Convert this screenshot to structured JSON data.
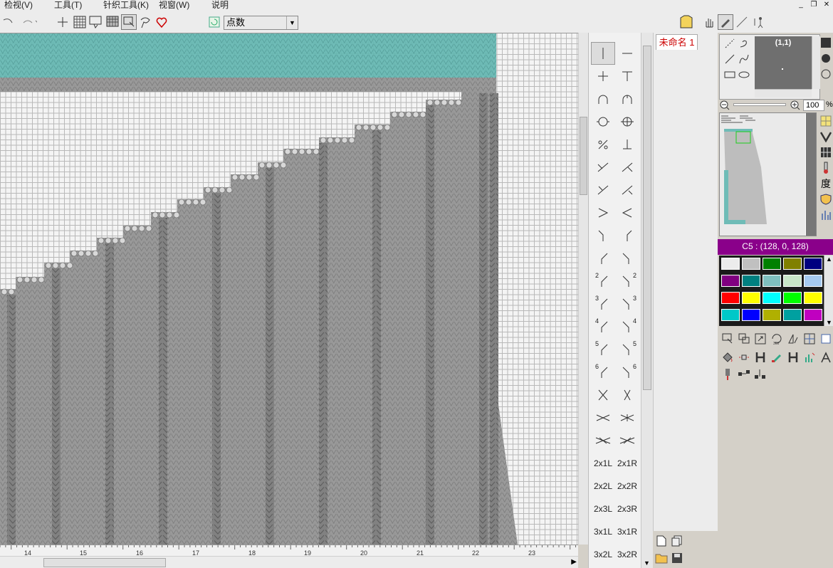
{
  "menu": {
    "view": "检视(V)",
    "tools": "工具(T)",
    "knit_tools": "针织工具(K)",
    "window": "视窗(W)",
    "help": "说明"
  },
  "window_controls": {
    "minimize": "_",
    "restore": "❐",
    "close": "✕"
  },
  "toolbar": {
    "mode_select_value": "点数",
    "icons": [
      "undo-icon",
      "redo-icon",
      "crosshair-icon",
      "grid-icon",
      "select-area-icon",
      "pattern-grid-icon",
      "select-drag-icon",
      "lasso-icon",
      "heart-icon",
      "refresh-icon"
    ]
  },
  "ruler": {
    "ticks": [
      "14",
      "15",
      "16",
      "17",
      "18",
      "19",
      "20",
      "21",
      "22",
      "23"
    ]
  },
  "symbols": {
    "labels": [
      {
        "left": "2x1L",
        "right": "2x1R"
      },
      {
        "left": "2x2L",
        "right": "2x2R"
      },
      {
        "left": "2x3L",
        "right": "2x3R"
      },
      {
        "left": "3x1L",
        "right": "3x1R"
      },
      {
        "left": "3x2L",
        "right": "3x2R"
      }
    ],
    "numbers": [
      "2",
      "2",
      "3",
      "3",
      "4",
      "4",
      "5",
      "5",
      "6",
      "6"
    ]
  },
  "document": {
    "tab_label": "未命名 1"
  },
  "right_panel": {
    "preview_coords": "(1,1)",
    "zoom_value": "100",
    "zoom_unit": "%",
    "color_label": "C5 : (128, 0, 128)",
    "side_text": "度",
    "palette": [
      [
        "#ececec",
        "#c0c0c0",
        "#008000",
        "#808000",
        "#000080"
      ],
      [
        "#800080",
        "#008080",
        "#7fbfbf",
        "#c8e6c8",
        "#a6caf0"
      ],
      [
        "#ff0000",
        "#ffff00",
        "#00ffff",
        "#00ff00",
        "#ffff00"
      ],
      [
        "#00c8c8",
        "#0000ff",
        "#b0b000",
        "#00a0a0",
        "#c000c0"
      ]
    ]
  },
  "colors": {
    "knit_gray": "#9a9a9a",
    "knit_teal": "#6fbcb7",
    "grid_bg": "#f4f4f4",
    "accent_purple": "#8a008a"
  }
}
